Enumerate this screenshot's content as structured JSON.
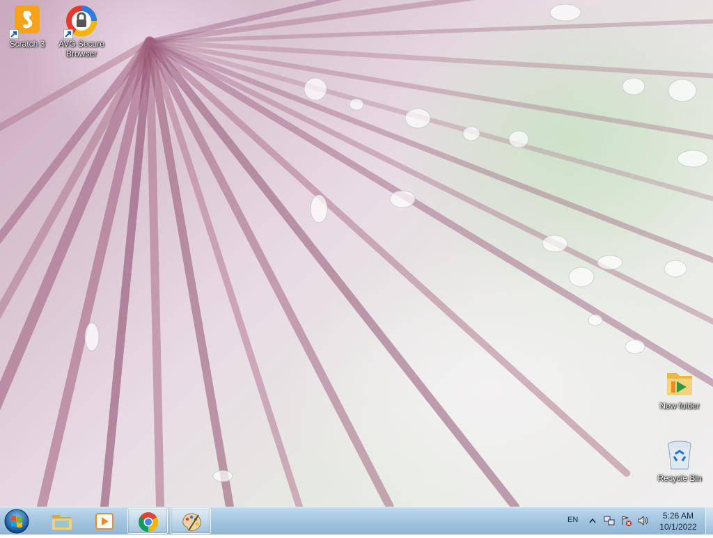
{
  "desktop": {
    "icons": [
      {
        "label": "Scratch 3",
        "icon": "scratch-icon"
      },
      {
        "label": "AVG Secure Browser",
        "icon": "avg-secure-browser-icon"
      },
      {
        "label": "New folder",
        "icon": "folder-icon"
      },
      {
        "label": "Recycle Bin",
        "icon": "recycle-bin-icon"
      }
    ]
  },
  "taskbar": {
    "start_icon": "windows-start-orb-icon",
    "buttons": [
      {
        "name": "windows-explorer",
        "icon": "folder-icon",
        "active": false
      },
      {
        "name": "media-player",
        "icon": "media-player-icon",
        "active": false
      },
      {
        "name": "google-chrome",
        "icon": "chrome-icon",
        "active": true
      },
      {
        "name": "paint",
        "icon": "paint-palette-icon",
        "active": true
      }
    ],
    "tray": {
      "language": "EN",
      "icons": [
        "show-hidden-icons-chevron-icon",
        "network-icon",
        "action-center-icon",
        "volume-icon"
      ]
    },
    "clock": {
      "time": "5:26 AM",
      "date": "10/1/2022"
    }
  },
  "colors": {
    "taskbar": "#a6c6e0",
    "desktop_label": "#ffffff"
  }
}
